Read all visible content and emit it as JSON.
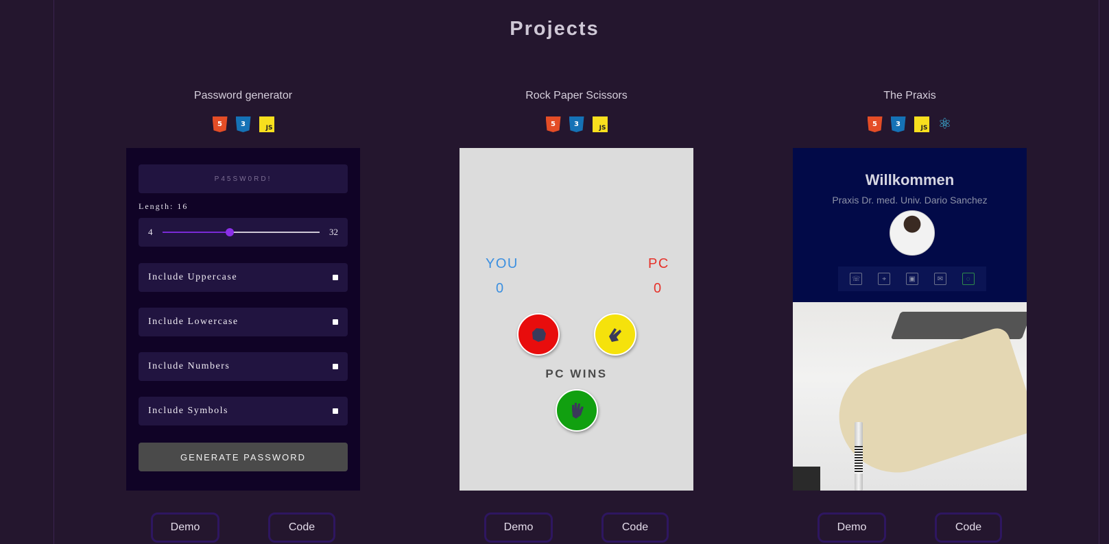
{
  "page": {
    "title": "Projects"
  },
  "projects": [
    {
      "title": "Password generator",
      "tech": [
        "html5",
        "css3",
        "js"
      ],
      "demo_label": "Demo",
      "code_label": "Code",
      "preview": {
        "output": "P45SW0RD!",
        "length_label": "Length: 16",
        "length_value": 16,
        "slider_min": "4",
        "slider_max": "32",
        "options": [
          "Include Uppercase",
          "Include Lowercase",
          "Include Numbers",
          "Include Symbols"
        ],
        "generate_label": "GENERATE PASSWORD"
      }
    },
    {
      "title": "Rock Paper Scissors",
      "tech": [
        "html5",
        "css3",
        "js"
      ],
      "demo_label": "Demo",
      "code_label": "Code",
      "preview": {
        "you_label": "YOU",
        "pc_label": "PC",
        "you_score": "0",
        "pc_score": "0",
        "result": "PC WINS"
      }
    },
    {
      "title": "The Praxis",
      "tech": [
        "html5",
        "css3",
        "js",
        "react"
      ],
      "demo_label": "Demo",
      "code_label": "Code",
      "preview": {
        "heading": "Willkommen",
        "subtitle": "Praxis Dr. med. Univ. Dario Sanchez",
        "contact_icons": [
          "phone-icon",
          "location-icon",
          "video-icon",
          "mail-icon",
          "whatsapp-icon"
        ]
      }
    }
  ],
  "tech_icons": {
    "html5": "5",
    "css3": "3",
    "js": "JS",
    "react": "⚛"
  }
}
